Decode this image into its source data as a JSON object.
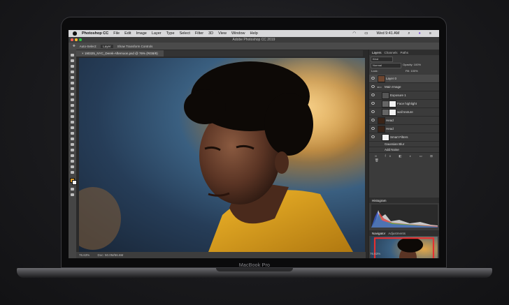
{
  "device": {
    "model_label": "MacBook Pro"
  },
  "menubar": {
    "app_name": "Photoshop CC",
    "items": [
      "File",
      "Edit",
      "Image",
      "Layer",
      "Type",
      "Select",
      "Filter",
      "3D",
      "View",
      "Window",
      "Help"
    ],
    "clock": "Wed 9:41 AM"
  },
  "window": {
    "title": "Adobe Photoshop CC 2019"
  },
  "options_bar": {
    "auto_select": "Auto-Select:",
    "auto_select_value": "Layer",
    "show_transform": "Show Transform Controls"
  },
  "document": {
    "tab_label": "190325_NYC_Derek-Afternoon.psd @ 76% (RGB/8)"
  },
  "status": {
    "zoom": "76.63%",
    "doc_size": "Doc: 50.0M/56.6M"
  },
  "panels": {
    "layers_tabs": [
      "Layers",
      "Channels",
      "Paths"
    ],
    "kind_label": "Kind",
    "blend_mode": "Normal",
    "opacity_label": "Opacity:",
    "opacity_value": "100%",
    "lock_label": "Lock:",
    "fill_label": "Fill:",
    "fill_value": "100%",
    "layers": [
      {
        "name": "Layer 0"
      },
      {
        "name": "Main Image"
      },
      {
        "name": "Exposure 1"
      },
      {
        "name": "Face highlight"
      },
      {
        "name": "wall texture"
      },
      {
        "name": "Head"
      },
      {
        "name": "Head"
      },
      {
        "name": "Smart Filters"
      },
      {
        "name": "Gaussian Blur"
      },
      {
        "name": "Add Noise"
      }
    ],
    "histogram_title": "Histogram",
    "navigator_tabs": [
      "Navigator",
      "Adjustments"
    ],
    "navigator_zoom": "76.63%"
  }
}
